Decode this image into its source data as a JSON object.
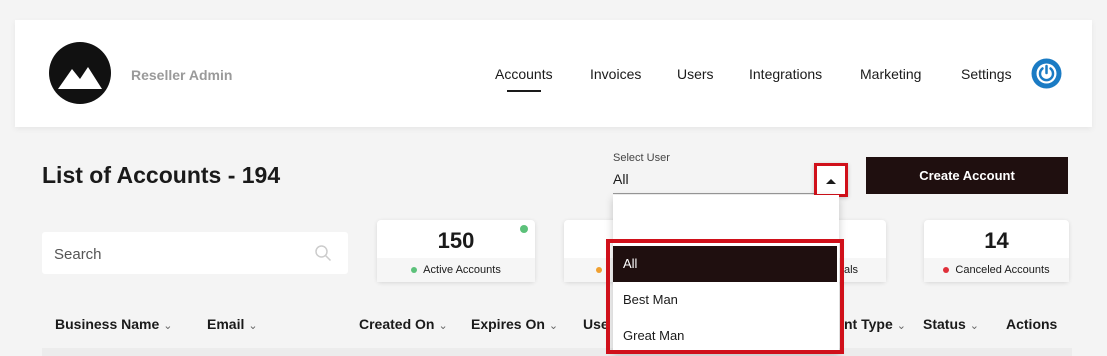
{
  "header": {
    "brand": "Reseller Admin",
    "nav": [
      "Accounts",
      "Invoices",
      "Users",
      "Integrations",
      "Marketing",
      "Settings"
    ],
    "active_nav": "Accounts"
  },
  "page": {
    "title": "List of Accounts - 194",
    "create_button": "Create Account",
    "search_placeholder": "Search"
  },
  "select_user": {
    "label": "Select User",
    "value": "All",
    "options": [
      "All",
      "Best Man",
      "Great Man"
    ],
    "selected_option": "All"
  },
  "stats": [
    {
      "value": "150",
      "label": "Active Accounts",
      "color": "#5cc17a"
    },
    {
      "value": "14",
      "label": "Canceled Accounts",
      "color": "#e0303a"
    }
  ],
  "stats_partial": {
    "label_fragment": "als",
    "dot_color": "#f0a030"
  },
  "table": {
    "columns": [
      "Business Name",
      "Email",
      "Created On",
      "Expires On",
      "Use",
      "nt Type",
      "Status",
      "Actions"
    ]
  },
  "colors": {
    "accent": "#1f0f0f",
    "highlight": "#d0101a",
    "power": "#1a7bc4"
  }
}
